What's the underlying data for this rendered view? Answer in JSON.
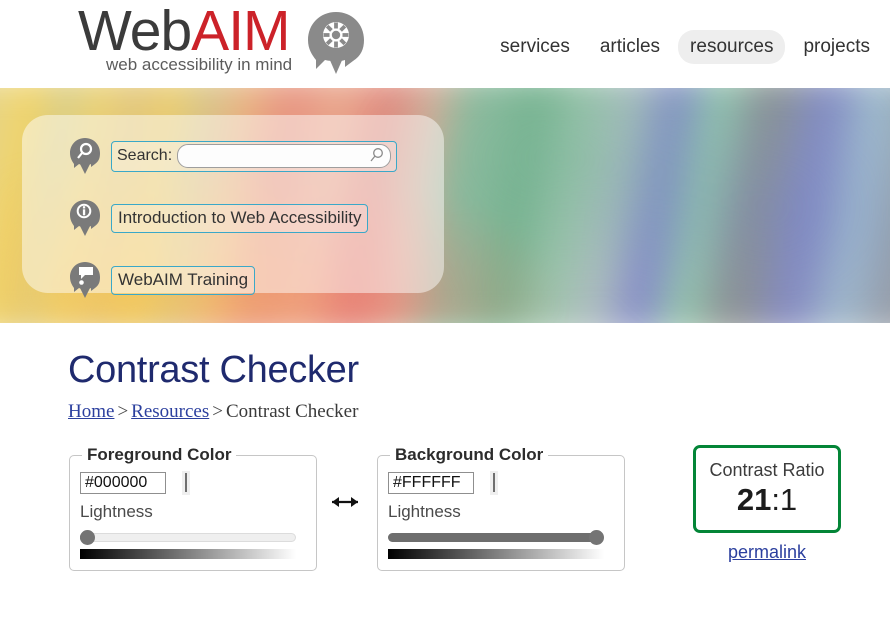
{
  "site": {
    "logo": {
      "word_dark": "Web",
      "word_red": "AIM",
      "tagline": "web accessibility in mind",
      "head_icon": "head-gear-icon",
      "red": "#cc2229",
      "dark": "#3b3b3b"
    },
    "nav": {
      "items": [
        {
          "label": "services",
          "active": false
        },
        {
          "label": "articles",
          "active": false
        },
        {
          "label": "resources",
          "active": true
        },
        {
          "label": "projects",
          "active": false
        }
      ],
      "active_bg": "#eeeeee"
    }
  },
  "banner": {
    "panel": {
      "search": {
        "label": "Search:",
        "value": "",
        "placeholder": "",
        "icon": "magnifier-icon",
        "pin_icon": "head-magnifier-icon",
        "border_color": "#3aa8c8"
      },
      "links": [
        {
          "label": "Introduction to Web Accessibility",
          "pin_icon": "head-info-icon"
        },
        {
          "label": "WebAIM Training",
          "pin_icon": "head-speech-bubble-icon"
        }
      ]
    }
  },
  "page": {
    "title": "Contrast Checker",
    "title_color": "#1f2a6e",
    "breadcrumb": {
      "home": "Home",
      "resources": "Resources",
      "current": "Contrast Checker",
      "separator": ">"
    }
  },
  "checker": {
    "foreground": {
      "legend": "Foreground Color",
      "hex_value": "#000000",
      "swatch_color": "#000000",
      "lightness_label": "Lightness",
      "lightness_percent": 0
    },
    "background": {
      "legend": "Background Color",
      "hex_value": "#FFFFFF",
      "swatch_color": "#FFFFFF",
      "lightness_label": "Lightness",
      "lightness_percent": 100
    },
    "swap": {
      "icon": "swap-horizontal-arrow-icon",
      "glyph": "↔"
    },
    "result": {
      "label": "Contrast Ratio",
      "ratio_number": "21",
      "ratio_suffix": ":1",
      "border_color": "#038537",
      "permalink_label": "permalink"
    }
  }
}
